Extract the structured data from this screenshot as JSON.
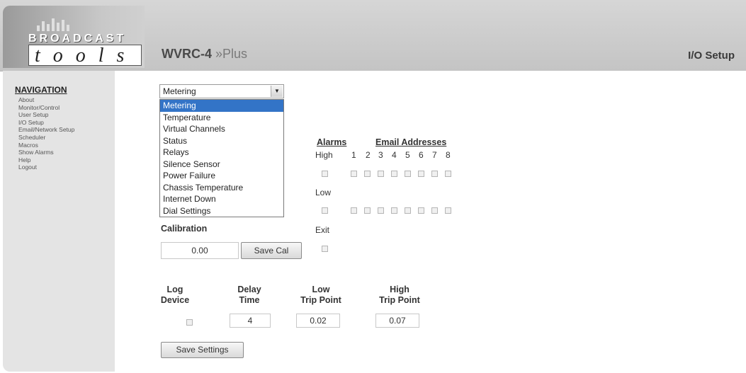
{
  "header": {
    "logo_broadcast": "BROADCAST",
    "logo_tools": "tools",
    "model_name": "WVRC-4",
    "model_suffix": "»Plus",
    "page_name": "I/O Setup"
  },
  "sidebar": {
    "title": "NAVIGATION",
    "items": [
      "About",
      "Monitor/Control",
      "User Setup",
      "I/O Setup",
      "Email/Network Setup",
      "Scheduler",
      "Macros",
      "Show Alarms",
      "Help",
      "Logout"
    ]
  },
  "selector": {
    "selected": "Metering",
    "options": [
      "Metering",
      "Temperature",
      "Virtual Channels",
      "Status",
      "Relays",
      "Silence Sensor",
      "Power Failure",
      "Chassis Temperature",
      "Internet Down",
      "Dial Settings"
    ]
  },
  "alarms": {
    "title": "Alarms",
    "emails_title": "Email Addresses",
    "high_label": "High",
    "low_label": "Low",
    "exit_label": "Exit",
    "email_numbers": [
      "1",
      "2",
      "3",
      "4",
      "5",
      "6",
      "7",
      "8"
    ]
  },
  "calibration": {
    "label": "Calibration",
    "value": "0.00",
    "save_label": "Save Cal"
  },
  "settings": {
    "log_device_l1": "Log",
    "log_device_l2": "Device",
    "delay_l1": "Delay",
    "delay_l2": "Time",
    "low_l1": "Low",
    "low_l2": "Trip Point",
    "high_l1": "High",
    "high_l2": "Trip Point",
    "delay_value": "4",
    "low_value": "0.02",
    "high_value": "0.07",
    "save_label": "Save Settings"
  },
  "colors": {
    "selected_option": "#3374c7",
    "header_bg": "#cccccc",
    "sidebar_bg": "#e4e4e4"
  }
}
